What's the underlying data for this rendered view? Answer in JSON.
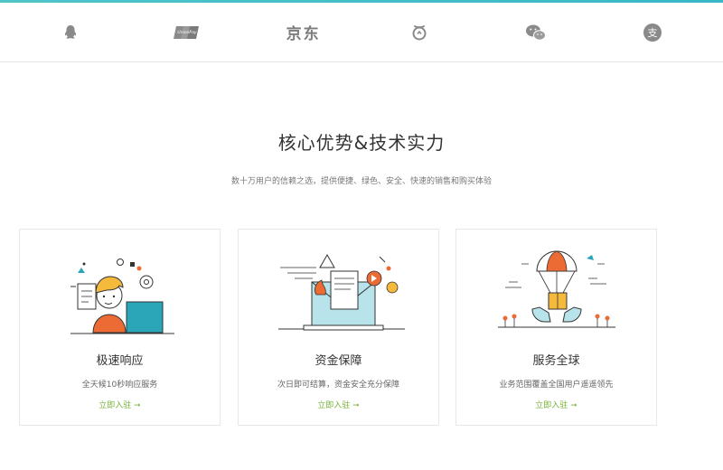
{
  "partners": [
    {
      "name": "qq-icon"
    },
    {
      "name": "unionpay-icon",
      "text": "UnionPay"
    },
    {
      "name": "jd-logo",
      "text": "京东"
    },
    {
      "name": "tenpay-icon"
    },
    {
      "name": "wechat-icon"
    },
    {
      "name": "alipay-icon",
      "text": "支"
    }
  ],
  "section": {
    "title": "核心优势&技术实力",
    "subtitle": "数十万用户的信赖之选，提供便捷、绿色、安全、快速的销售和购买体验"
  },
  "cards": [
    {
      "icon": "support-agent-illustration",
      "title": "极速响应",
      "desc": "全天候10秒响应服务",
      "link": "立即入驻 ➞"
    },
    {
      "icon": "laptop-finance-illustration",
      "title": "资金保障",
      "desc": "次日即可结算，资金安全充分保障",
      "link": "立即入驻 ➞"
    },
    {
      "icon": "parachute-delivery-illustration",
      "title": "服务全球",
      "desc": "业务范围覆盖全国用户遥遥领先",
      "link": "立即入驻 ➞"
    }
  ],
  "colors": {
    "accent_green": "#78b43a",
    "topline": "#4fc4c9",
    "icon_gray": "#8a8a8a"
  }
}
